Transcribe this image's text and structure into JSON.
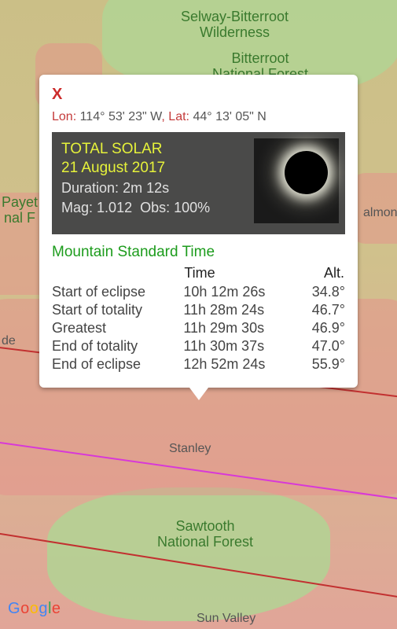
{
  "map": {
    "labels": {
      "selway": "Selway-Bitterroot\nWilderness",
      "bitterroot": "Bitterroot\nNational Forest",
      "payette": "Payet\nnal F",
      "salmon": "almon",
      "de": "de",
      "stanley": "Stanley",
      "sawtooth": "Sawtooth\nNational Forest",
      "sunvalley": "Sun Valley"
    },
    "attribution": "Google"
  },
  "popup": {
    "close": "X",
    "lon_label": "Lon:",
    "lon_value": "114° 53' 23\" W",
    "lat_label": "Lat:",
    "lat_value": "44° 13' 05\" N",
    "banner": {
      "title_line1": "TOTAL SOLAR",
      "title_line2": "21 August 2017",
      "duration_label": "Duration:",
      "duration_value": "2m 12s",
      "mag_label": "Mag:",
      "mag_value": "1.012",
      "obs_label": "Obs:",
      "obs_value": "100%"
    },
    "timezone": "Mountain Standard Time",
    "table": {
      "headers": {
        "event": "",
        "time": "Time",
        "alt": "Alt."
      },
      "rows": [
        {
          "event": "Start of eclipse",
          "time": "10h 12m 26s",
          "alt": "34.8°"
        },
        {
          "event": "Start of totality",
          "time": "11h 28m 24s",
          "alt": "46.7°"
        },
        {
          "event": "Greatest",
          "time": "11h 29m 30s",
          "alt": "46.9°"
        },
        {
          "event": "End of totality",
          "time": "11h 30m 37s",
          "alt": "47.0°"
        },
        {
          "event": "End of eclipse",
          "time": "12h 52m 24s",
          "alt": "55.9°"
        }
      ]
    }
  }
}
